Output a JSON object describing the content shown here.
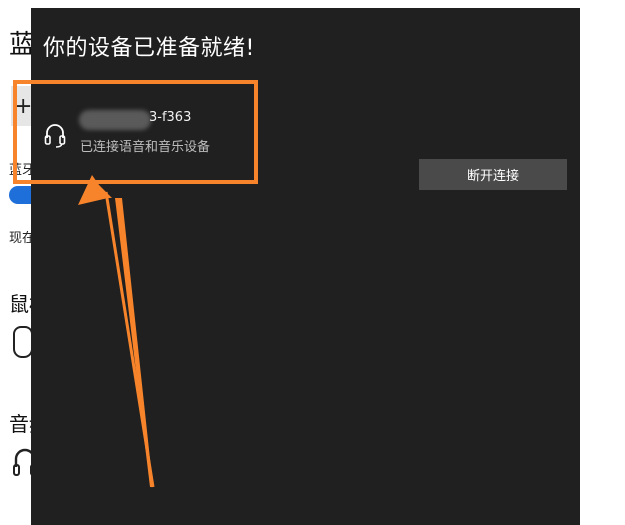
{
  "background": {
    "title": "蓝",
    "add_symbol": "+",
    "bluetooth_label": "蓝牙",
    "now_label": "现在",
    "mouse_heading": "鼠标",
    "audio_heading": "音频",
    "toggle_color": "#1e6fd9"
  },
  "dialog": {
    "title": "你的设备已准备就绪!",
    "device": {
      "name_visible": "3-f363",
      "status": "已连接语音和音乐设备",
      "icon": "headset-icon"
    },
    "disconnect_button": "断开连接"
  },
  "annotation": {
    "color": "#f7842b"
  }
}
